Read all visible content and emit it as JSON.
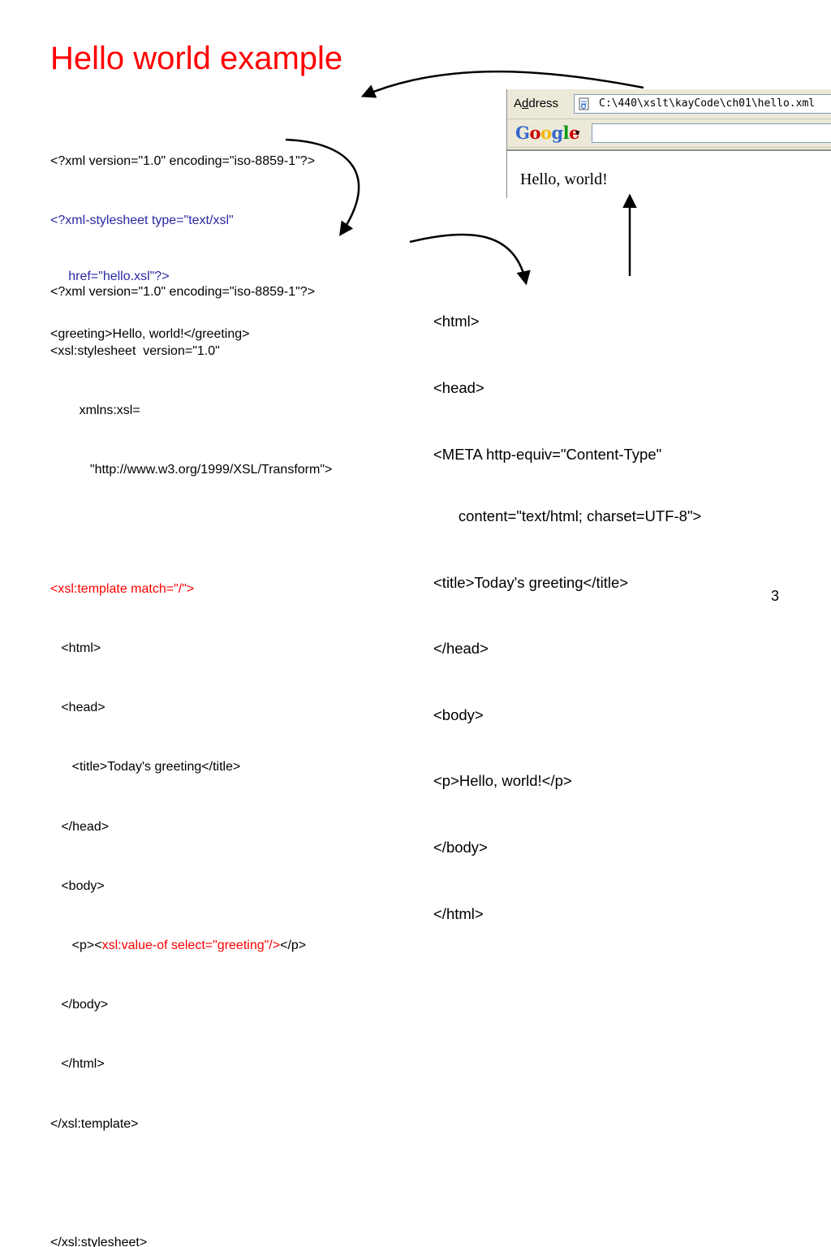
{
  "slide": {
    "title": "Hello world example",
    "page_number": "3"
  },
  "xml_source": {
    "line1": "<?xml version=\"1.0\" encoding=\"iso-8859-1\"?>",
    "line2": "<?xml-stylesheet type=\"text/xsl\"",
    "line3": "     href=\"hello.xsl\"?>",
    "line4": "<greeting>Hello, world!</greeting>"
  },
  "xsl_source": {
    "line1": "<?xml version=\"1.0\" encoding=\"iso-8859-1\"?>",
    "line2": "<xsl:stylesheet  version=\"1.0\"",
    "line3": "        xmlns:xsl=",
    "line4": "           \"http://www.w3.org/1999/XSL/Transform\">",
    "line5": "",
    "line6": "<xsl:template match=\"/\">",
    "line7": "   <html>",
    "line8": "   <head>",
    "line9": "      <title>Today's greeting</title>",
    "line10": "   </head>",
    "line11": "   <body>",
    "line12_pre": "      <p><",
    "line12_red": "xsl:value-of select=\"greeting\"/>",
    "line12_post": "</p>",
    "line13": "   </body>",
    "line14": "   </html>",
    "line15": "</xsl:template>",
    "line16": "",
    "line17": "</xsl:stylesheet>"
  },
  "html_output": {
    "line1": "<html>",
    "line2": "<head>",
    "line3": "<META http-equiv=\"Content-Type\"",
    "line4": "      content=\"text/html; charset=UTF-8\">",
    "line5": "<title>Today's greeting</title>",
    "line6": "</head>",
    "line7": "<body>",
    "line8": "<p>Hello, world!</p>",
    "line9": "</body>",
    "line10": "</html>"
  },
  "browser": {
    "address_label_pre": "A",
    "address_label_underlined": "d",
    "address_label_post": "dress",
    "address_value": "C:\\440\\xslt\\kayCode\\ch01\\hello.xml",
    "google_caret": "▾",
    "content_text": "Hello, world!"
  },
  "google_logo_letters": [
    {
      "char": "G",
      "color": "#3366cc"
    },
    {
      "char": "o",
      "color": "#cc0000"
    },
    {
      "char": "o",
      "color": "#f5b800"
    },
    {
      "char": "g",
      "color": "#3366cc"
    },
    {
      "char": "l",
      "color": "#109618"
    },
    {
      "char": "e",
      "color": "#cc0000"
    }
  ],
  "colors": {
    "title": "#ff0000",
    "stylesheet_pi": "#2929a3",
    "xsl_instruction": "#ff0000"
  }
}
